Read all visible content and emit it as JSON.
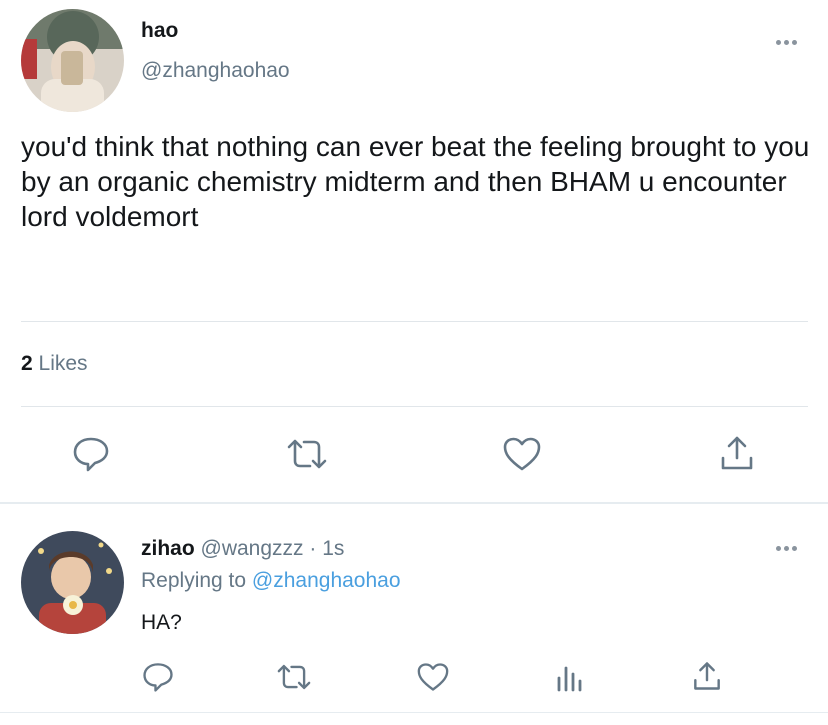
{
  "main_tweet": {
    "author_name": "hao",
    "author_handle": "@zhanghaohao",
    "text": "you'd think that nothing can ever beat the feeling brought to you by an organic chemistry midterm and then BHAM u encounter lord voldemort",
    "likes_count": "2",
    "likes_label": "Likes",
    "avatar": "avatar-photo",
    "more_icon": "more-horizontal-icon",
    "actions": [
      "reply-icon",
      "retweet-icon",
      "like-icon",
      "share-icon"
    ]
  },
  "reply_tweet": {
    "author_name": "zihao",
    "author_handle": "@wangzzz",
    "separator": "·",
    "time": "1s",
    "replying_prefix": "Replying to",
    "replying_handle": "@zhanghaohao",
    "text": "HA?",
    "avatar": "avatar-photo",
    "more_icon": "more-horizontal-icon",
    "actions": [
      "reply-icon",
      "retweet-icon",
      "like-icon",
      "analytics-icon",
      "share-icon"
    ]
  },
  "colors": {
    "text_primary": "#14171a",
    "text_secondary": "#657786",
    "link": "#4a9fdf",
    "icon": "#657786",
    "divider": "#e1e6ea"
  }
}
